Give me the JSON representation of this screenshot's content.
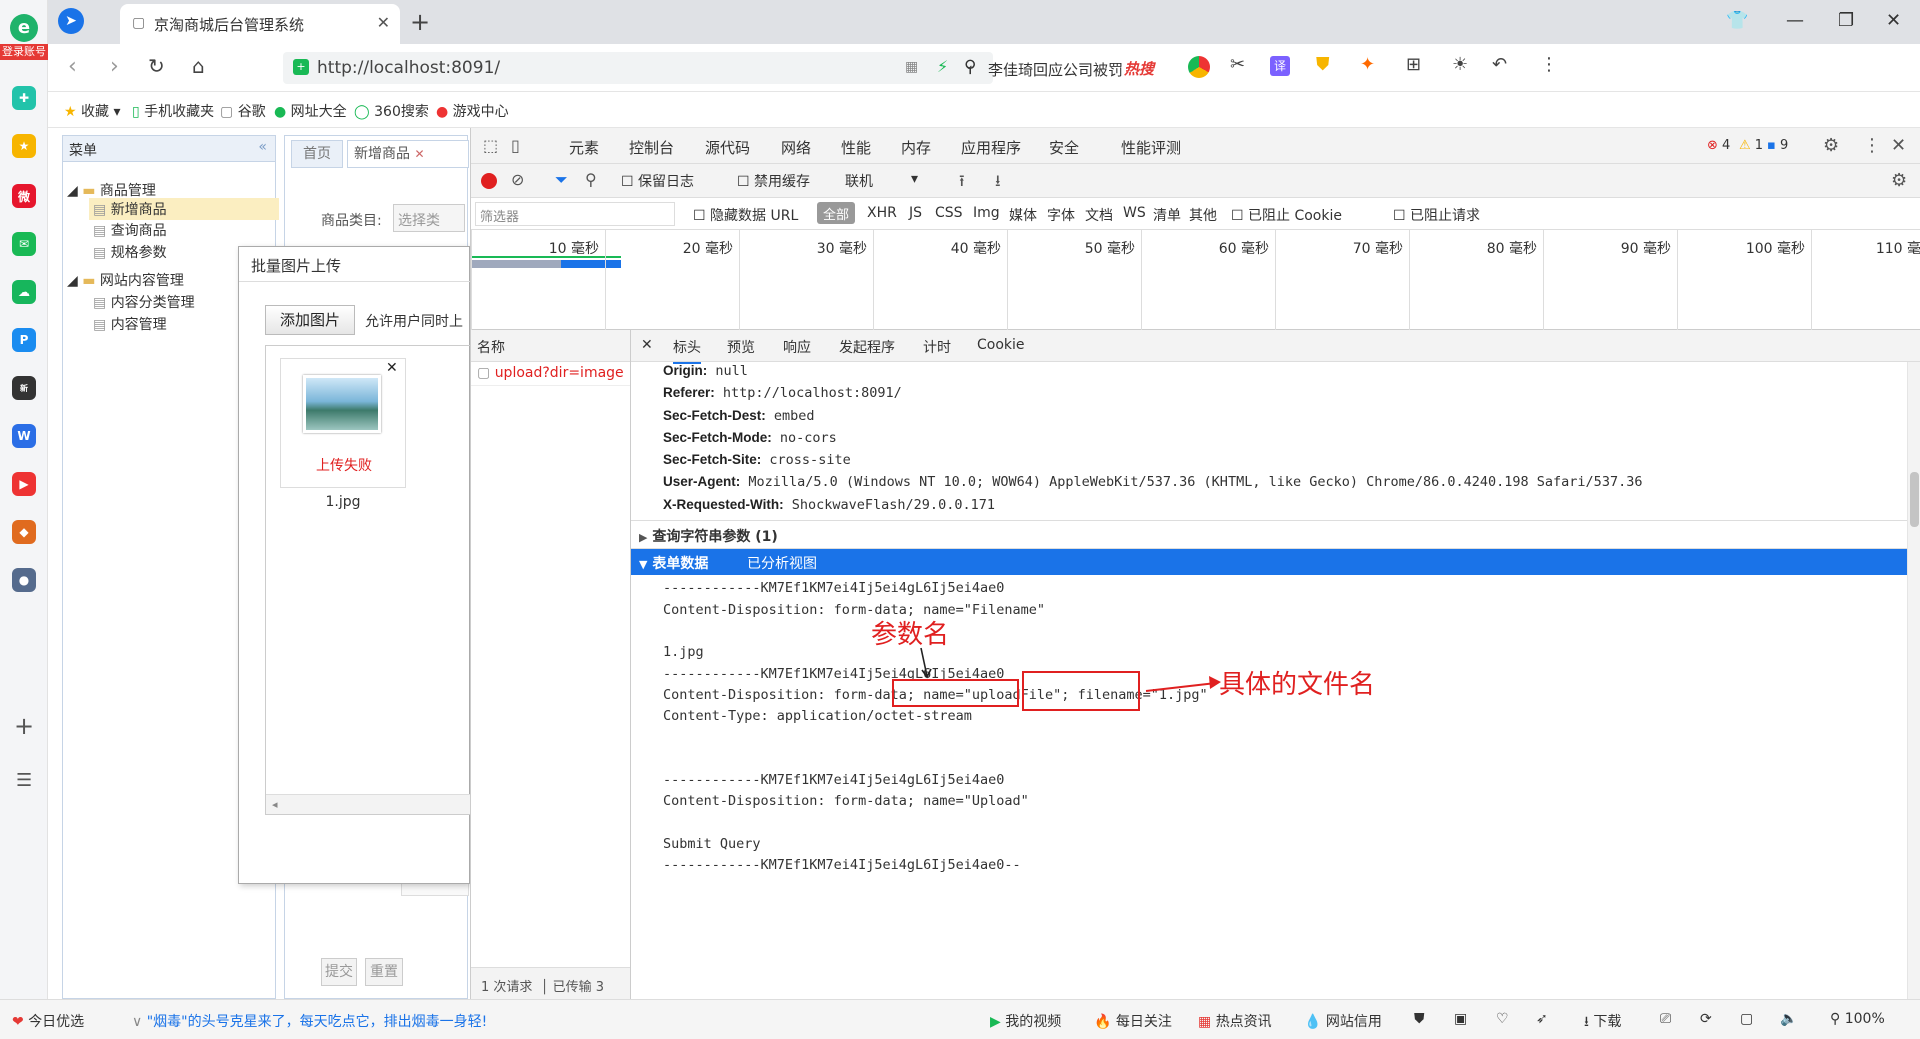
{
  "sidebar": {
    "login_badge": "登录账号",
    "app_icons": [
      "leaf-icon",
      "star-icon",
      "weibo-icon",
      "mail-icon",
      "cloud-icon",
      "p-icon",
      "news-icon",
      "doc-icon",
      "video-icon",
      "game-icon",
      "game2-icon"
    ]
  },
  "browser": {
    "tab_title": "京淘商城后台管理系统",
    "url": "http://localhost:8091/",
    "search_text": "李佳琦回应公司被罚",
    "search_hot": "热搜",
    "bookmarks": [
      "收藏",
      "手机收藏夹",
      "谷歌",
      "网址大全",
      "360搜索",
      "游戏中心"
    ]
  },
  "admin": {
    "menu_title": "菜单",
    "tree": [
      "商品管理",
      "新增商品",
      "查询商品",
      "规格参数",
      "网站内容管理",
      "内容分类管理",
      "内容管理"
    ],
    "tabs": [
      "首页",
      "新增商品"
    ],
    "category_label": "商品类目:",
    "category_btn": "选择类",
    "submit": "提交",
    "reset": "重置"
  },
  "dialog": {
    "title": "批量图片上传",
    "add_btn": "添加图片",
    "hint": "允许用户同时上",
    "status": "上传失败",
    "filename": "1.jpg"
  },
  "devtools": {
    "tabs": [
      "元素",
      "控制台",
      "源代码",
      "网络",
      "性能",
      "内存",
      "应用程序",
      "安全",
      "性能评测"
    ],
    "errors": "4",
    "warnings": "1",
    "messages": "9",
    "preserve_log": "保留日志",
    "disable_cache": "禁用缓存",
    "throttle": "联机",
    "filter_placeholder": "筛选器",
    "hide_data": "隐藏数据 URL",
    "types": [
      "全部",
      "XHR",
      "JS",
      "CSS",
      "Img",
      "媒体",
      "字体",
      "文档",
      "WS",
      "清单",
      "其他"
    ],
    "block_cookie": "已阻止 Cookie",
    "block_req": "已阻止请求",
    "ticks": [
      "10 毫秒",
      "20 毫秒",
      "30 毫秒",
      "40 毫秒",
      "50 毫秒",
      "60 毫秒",
      "70 毫秒",
      "80 毫秒",
      "90 毫秒",
      "100 毫秒",
      "110 毫"
    ],
    "name_header": "名称",
    "request_name": "upload?dir=image",
    "requests_count": "1 次请求",
    "transferred": "已传输 3",
    "detail_tabs": [
      "标头",
      "预览",
      "响应",
      "发起程序",
      "计时",
      "Cookie"
    ],
    "headers": [
      {
        "k": "Origin:",
        "v": "null"
      },
      {
        "k": "Referer:",
        "v": "http://localhost:8091/"
      },
      {
        "k": "Sec-Fetch-Dest:",
        "v": "embed"
      },
      {
        "k": "Sec-Fetch-Mode:",
        "v": "no-cors"
      },
      {
        "k": "Sec-Fetch-Site:",
        "v": "cross-site"
      },
      {
        "k": "User-Agent:",
        "v": "Mozilla/5.0 (Windows NT 10.0; WOW64) AppleWebKit/537.36 (KHTML, like Gecko) Chrome/86.0.4240.198 Safari/537.36"
      },
      {
        "k": "X-Requested-With:",
        "v": "ShockwaveFlash/29.0.0.171"
      }
    ],
    "query_section": "查询字符串参数 (1)",
    "form_section": "表单数据",
    "parsed_view": "已分析视图",
    "form_lines": [
      "------------KM7Ef1KM7ei4Ij5ei4gL6Ij5ei4ae0",
      "Content-Disposition: form-data; name=\"Filename\"",
      "",
      "1.jpg",
      "------------KM7Ef1KM7ei4Ij5ei4gL6Ij5ei4ae0",
      "Content-Disposition: form-data;",
      "Content-Type: application/octet-stream",
      "",
      "",
      "------------KM7Ef1KM7ei4Ij5ei4gL6Ij5ei4ae0",
      "Content-Disposition: form-data; name=\"Upload\"",
      "",
      "Submit Query",
      "------------KM7Ef1KM7ei4Ij5ei4gL6Ij5ei4ae0--"
    ],
    "name_part": "name=\"uploadFile\";",
    "filename_part": "filename=\"1.jpg\"",
    "annot_param": "参数名",
    "annot_file": "具体的文件名"
  },
  "statusbar": {
    "left": "今日优选",
    "news": "\"烟毒\"的头号克星来了，每天吃点它，排出烟毒一身轻!",
    "items": [
      "我的视频",
      "每日关注",
      "热点资讯",
      "网站信用",
      "下载"
    ],
    "zoom": "100%"
  }
}
